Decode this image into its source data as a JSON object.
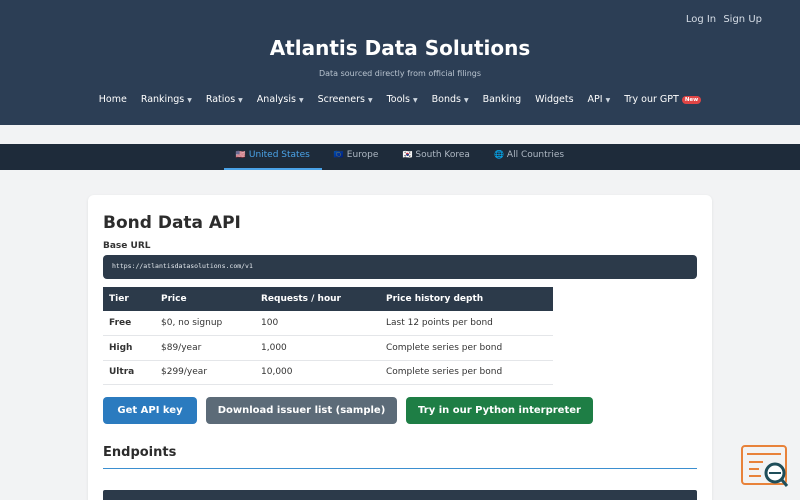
{
  "header": {
    "login": "Log In",
    "signup": "Sign Up",
    "title": "Atlantis Data Solutions",
    "subtitle": "Data sourced directly from official filings",
    "nav": [
      {
        "label": "Home",
        "caret": false
      },
      {
        "label": "Rankings",
        "caret": true
      },
      {
        "label": "Ratios",
        "caret": true
      },
      {
        "label": "Analysis",
        "caret": true
      },
      {
        "label": "Screeners",
        "caret": true
      },
      {
        "label": "Tools",
        "caret": true
      },
      {
        "label": "Bonds",
        "caret": true
      },
      {
        "label": "Banking",
        "caret": false
      },
      {
        "label": "Widgets",
        "caret": false
      },
      {
        "label": "API",
        "caret": true
      },
      {
        "label": "Try our GPT",
        "caret": false
      }
    ],
    "new_badge": "New"
  },
  "regions": [
    {
      "flag": "🇺🇸",
      "label": "United States",
      "active": true
    },
    {
      "flag": "🇪🇺",
      "label": "Europe",
      "active": false
    },
    {
      "flag": "🇰🇷",
      "label": "South Korea",
      "active": false
    },
    {
      "flag": "🌐",
      "label": "All Countries",
      "active": false
    }
  ],
  "main": {
    "title": "Bond Data API",
    "base_url_label": "Base URL",
    "base_url": "https://atlantisdatasolutions.com/v1",
    "tiers_table": {
      "headers": [
        "Tier",
        "Price",
        "Requests / hour",
        "Price history depth"
      ],
      "rows": [
        [
          "Free",
          "$0, no signup",
          "100",
          "Last 12 points per bond"
        ],
        [
          "High",
          "$89/year",
          "1,000",
          "Complete series per bond"
        ],
        [
          "Ultra",
          "$299/year",
          "10,000",
          "Complete series per bond"
        ]
      ]
    },
    "buttons": {
      "get_api_key": "Get API key",
      "download": "Download issuer list (sample)",
      "python": "Try in our Python interpreter"
    },
    "endpoints_title": "Endpoints"
  },
  "colors": {
    "header_bg": "#2c3e55",
    "region_bar_bg": "#1e2b3a",
    "accent_blue": "#2b7bbf",
    "accent_green": "#1e7e45",
    "button_gray": "#5c6b78",
    "widget_orange": "#e8823a"
  },
  "icons": {
    "widget": "search-chat-icon"
  }
}
